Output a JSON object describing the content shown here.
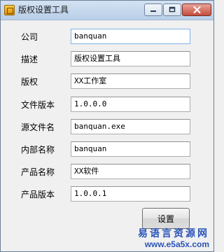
{
  "window": {
    "title": "版权设置工具",
    "controls": {
      "minimize": "minimize",
      "maximize": "maximize",
      "close": "close"
    }
  },
  "form": {
    "fields": [
      {
        "label": "公司",
        "value": "banquan"
      },
      {
        "label": "描述",
        "value": "版权设置工具"
      },
      {
        "label": "版权",
        "value": "XX工作室"
      },
      {
        "label": "文件版本",
        "value": "1.0.0.0"
      },
      {
        "label": "源文件名",
        "value": "banquan.exe"
      },
      {
        "label": "内部名称",
        "value": "banquan"
      },
      {
        "label": "产品名称",
        "value": "XX软件"
      },
      {
        "label": "产品版本",
        "value": "1.0.0.1"
      }
    ],
    "submit_label": "设置"
  },
  "watermark": {
    "line1": "易语言资源网",
    "line2": "www.e5a5x.com"
  },
  "colors": {
    "titlebar": "#c4d7ec",
    "close_button": "#c54c3a",
    "watermark": "#2a54b8",
    "focus_border": "#7eb4ea"
  }
}
